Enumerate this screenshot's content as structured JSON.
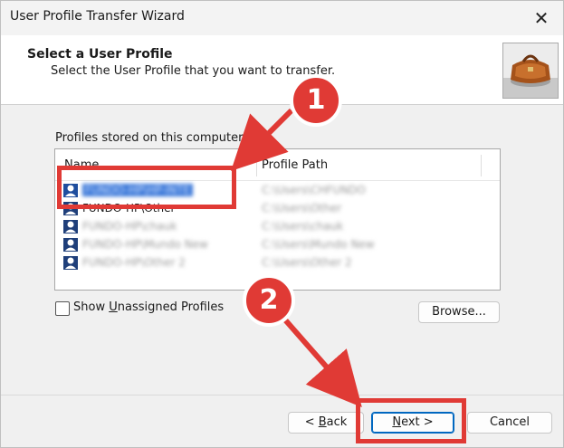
{
  "window": {
    "title": "User Profile Transfer Wizard",
    "close_glyph": "✕"
  },
  "header": {
    "title": "Select a User Profile",
    "subtitle": "Select the User Profile that you want to transfer."
  },
  "profiles": {
    "label": "Profiles stored on this computer:",
    "columns": [
      "Name",
      "Profile Path"
    ],
    "rows": [
      {
        "name": "FUNDO-HP\\HP-INTE",
        "path": "C:\\Users\\CHFUNDO",
        "selected": true
      },
      {
        "name": "FUNDO-HP\\Other",
        "path": "C:\\Users\\Other",
        "selected": false
      },
      {
        "name": "FUNDO-HP\\chauk",
        "path": "C:\\Users\\chauk",
        "selected": false
      },
      {
        "name": "FUNDO-HP\\Mundo New",
        "path": "C:\\Users\\Mundo New",
        "selected": false
      },
      {
        "name": "FUNDO-HP\\Other 2",
        "path": "C:\\Users\\Other 2",
        "selected": false
      }
    ]
  },
  "options": {
    "show_unassigned_pre": "Show ",
    "show_unassigned_mn": "U",
    "show_unassigned_post": "nassigned Profiles",
    "show_unassigned_checked": false
  },
  "buttons": {
    "browse": "Browse...",
    "back_pre": "< ",
    "back_mn": "B",
    "back_post": "ack",
    "next_mn": "N",
    "next_post": "ext >",
    "cancel": "Cancel"
  },
  "annotations": {
    "badge1": "1",
    "badge2": "2",
    "color": "#e03a35"
  },
  "icons": {
    "profile": "user-profile-icon",
    "header_image": "briefcase-icon"
  }
}
